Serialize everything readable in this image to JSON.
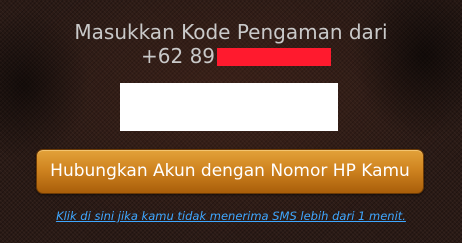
{
  "verification": {
    "title": "Masukkan Kode Pengaman dari",
    "phone_prefix": "+62 89",
    "code_input_value": "",
    "connect_button_label": "Hubungkan Akun dengan Nomor HP Kamu",
    "resend_link_text": "Klik di sini jika kamu tidak menerima SMS lebih dari 1 menit."
  },
  "colors": {
    "background": "#2a1a15",
    "title_text": "#c9c9c9",
    "redaction": "#ff1a2e",
    "button_top": "#e3a23a",
    "button_bottom": "#a95e0a",
    "link": "#3fa7ff"
  }
}
